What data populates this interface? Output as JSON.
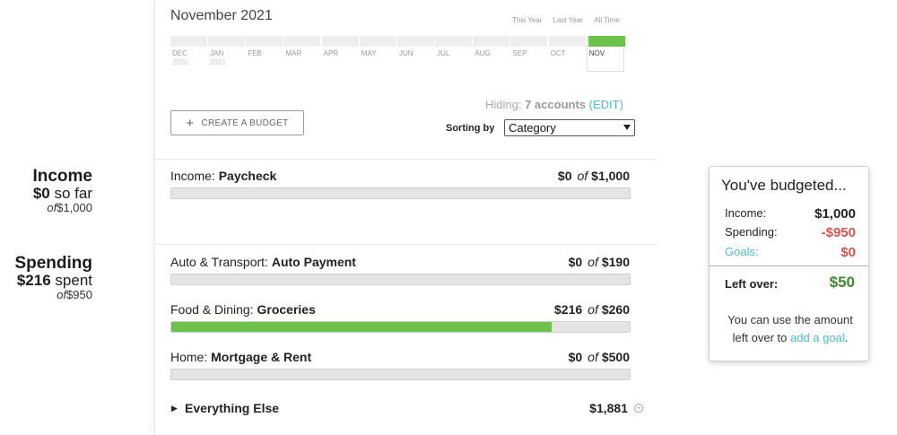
{
  "summary": {
    "income": {
      "title": "Income",
      "amount": "$0",
      "suffix": "so far",
      "of_word": "of",
      "of_value": "$1,000"
    },
    "spending": {
      "title": "Spending",
      "amount": "$216",
      "suffix": "spent",
      "of_word": "of",
      "of_value": "$950"
    }
  },
  "header": {
    "month_title": "November 2021",
    "range_links": [
      "This Year",
      "Last Year",
      "All Time"
    ]
  },
  "months": [
    {
      "label": "DEC",
      "year": "2020"
    },
    {
      "label": "JAN",
      "year": "2021"
    },
    {
      "label": "FEB",
      "year": ""
    },
    {
      "label": "MAR",
      "year": ""
    },
    {
      "label": "APR",
      "year": ""
    },
    {
      "label": "MAY",
      "year": ""
    },
    {
      "label": "JUN",
      "year": ""
    },
    {
      "label": "JUL",
      "year": ""
    },
    {
      "label": "AUG",
      "year": ""
    },
    {
      "label": "SEP",
      "year": ""
    },
    {
      "label": "OCT",
      "year": ""
    },
    {
      "label": "NOV",
      "year": ""
    }
  ],
  "active_month": "NOV",
  "hiding": {
    "prefix": "Hiding:",
    "count": "7 accounts",
    "edit": "(EDIT)"
  },
  "create_button": {
    "label": "CREATE A BUDGET"
  },
  "sorting": {
    "label": "Sorting by",
    "value": "Category"
  },
  "budgets": [
    {
      "category": "Income:",
      "name": "Paycheck",
      "spent": "$0",
      "of_word": "of",
      "total": "$1,000",
      "progress": 0
    },
    {
      "category": "Auto & Transport:",
      "name": "Auto Payment",
      "spent": "$0",
      "of_word": "of",
      "total": "$190",
      "progress": 0
    },
    {
      "category": "Food & Dining:",
      "name": "Groceries",
      "spent": "$216",
      "of_word": "of",
      "total": "$260",
      "progress": 0.83
    },
    {
      "category": "Home:",
      "name": "Mortgage & Rent",
      "spent": "$0",
      "of_word": "of",
      "total": "$500",
      "progress": 0
    }
  ],
  "everything_else": {
    "label": "Everything Else",
    "amount": "$1,881"
  },
  "card": {
    "title": "You've budgeted...",
    "income_label": "Income:",
    "income_value": "$1,000",
    "spending_label": "Spending:",
    "spending_value": "-$950",
    "goals_label": "Goals:",
    "goals_value": "$0",
    "leftover_label": "Left over:",
    "leftover_value": "$50",
    "note_prefix": "You can use the amount left over to",
    "note_link": "add a goal",
    "note_suffix": "."
  },
  "colors": {
    "green": "#6cc24a",
    "link": "#4fb9d4",
    "negative": "#d9534f",
    "leftover": "#3b8a2e"
  }
}
